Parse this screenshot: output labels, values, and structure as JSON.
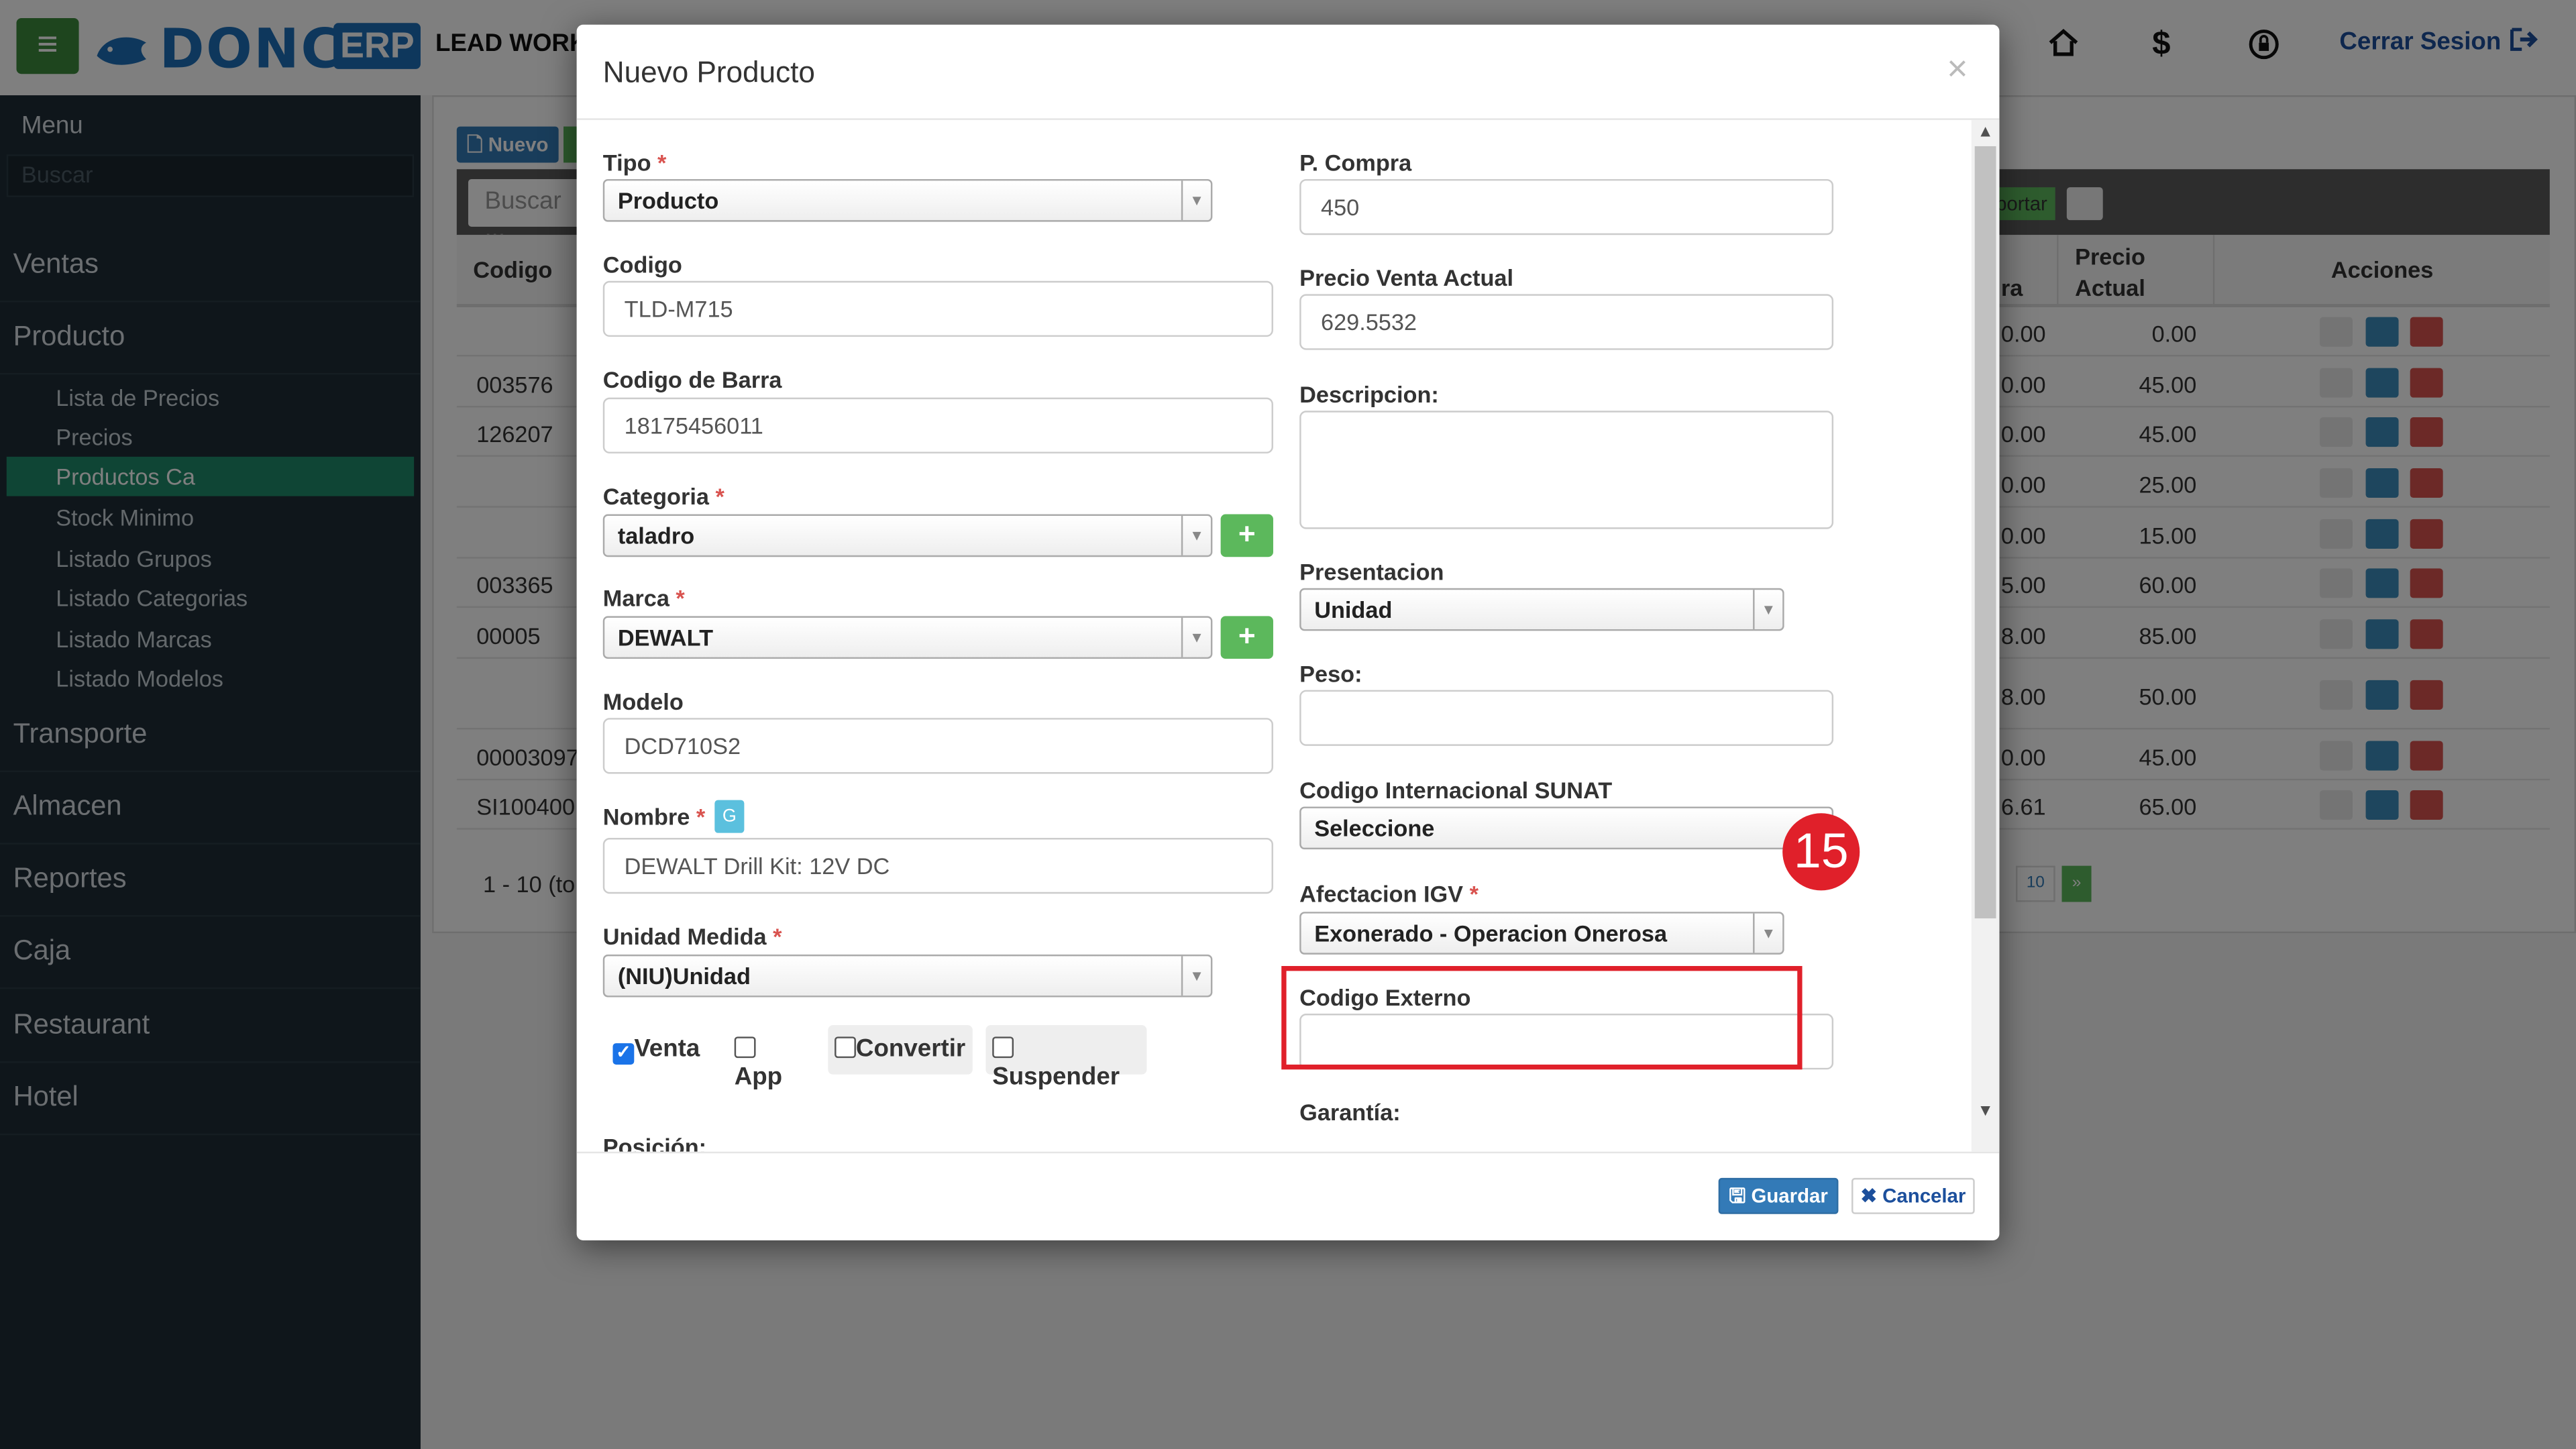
{
  "header": {
    "menu_toggle": "≡",
    "logo_text": "DONCA",
    "logo_badge": "ERP",
    "company": "LEAD WORK",
    "logout": "Cerrar Sesion",
    "icons": [
      "home-icon",
      "dollar-icon",
      "lock-refresh-icon",
      "logout-icon"
    ]
  },
  "sidebar": {
    "title": "Menu",
    "search_placeholder": "Buscar",
    "items": [
      "Ventas",
      "Producto",
      "Transporte",
      "Almacen",
      "Reportes",
      "Caja",
      "Restaurant",
      "Hotel"
    ],
    "product_subitems": [
      "Lista de Precios",
      "Precios",
      "Productos Ca",
      "Stock Minimo",
      "Listado Grupos",
      "Listado Categorias",
      "Listado Marcas",
      "Listado Modelos"
    ],
    "active_subitem": "Productos Ca"
  },
  "background": {
    "btn_nuevo": "Nuevo",
    "search_placeholder": "Buscar ...",
    "btn_exportar": "portar",
    "columns": {
      "codigo": "Codigo",
      "precio_compra": "ra",
      "precio_actual": "Precio Actual",
      "acciones": "Acciones"
    },
    "rows": [
      {
        "codigo": "",
        "ca": "0.00",
        "pa": "0.00"
      },
      {
        "codigo": "003576",
        "ca": "0.00",
        "pa": "45.00"
      },
      {
        "codigo": "126207",
        "ca": "0.00",
        "pa": "45.00"
      },
      {
        "codigo": "",
        "ca": "0.00",
        "pa": "25.00"
      },
      {
        "codigo": "",
        "ca": "0.00",
        "pa": "15.00"
      },
      {
        "codigo": "003365",
        "ca": "5.00",
        "pa": "60.00"
      },
      {
        "codigo": "00005",
        "ca": "8.00",
        "pa": "85.00"
      },
      {
        "codigo": "",
        "ca": "8.00",
        "pa": "50.00"
      },
      {
        "codigo": "00003097",
        "ca": "0.00",
        "pa": "45.00"
      },
      {
        "codigo": "SI100400",
        "ca": "6.61",
        "pa": "65.00"
      }
    ],
    "pagination_text": "1 - 10 (to",
    "page_10": "10",
    "page_next": "»"
  },
  "modal": {
    "title": "Nuevo Producto",
    "close": "×",
    "left": {
      "tipo_label": "Tipo",
      "tipo_value": "Producto",
      "codigo_label": "Codigo",
      "codigo_value": "TLD-M715",
      "barra_label": "Codigo de Barra",
      "barra_value": "18175456011",
      "categoria_label": "Categoria",
      "categoria_value": "taladro",
      "marca_label": "Marca",
      "marca_value": "DEWALT",
      "modelo_label": "Modelo",
      "modelo_value": "DCD710S2",
      "nombre_label": "Nombre",
      "nombre_badge": "G",
      "nombre_value": "DEWALT Drill Kit: 12V DC",
      "unidad_label": "Unidad Medida",
      "unidad_value": "(NIU)Unidad",
      "checkboxes": [
        {
          "label": "Venta",
          "checked": true
        },
        {
          "label": "App",
          "checked": false
        },
        {
          "label": "Convertir",
          "checked": false
        },
        {
          "label": "Suspender",
          "checked": false
        }
      ],
      "posicion_label": "Posición:"
    },
    "right": {
      "pcompra_label": "P. Compra",
      "pcompra_value": "450",
      "pventa_label": "Precio Venta Actual",
      "pventa_value": "629.5532",
      "descripcion_label": "Descripcion:",
      "descripcion_value": "",
      "presentacion_label": "Presentacion",
      "presentacion_value": "Unidad",
      "peso_label": "Peso:",
      "peso_value": "",
      "sunat_label": "Codigo Internacional SUNAT",
      "sunat_value": "Seleccione",
      "igv_label": "Afectacion IGV",
      "igv_value": "Exonerado - Operacion Onerosa",
      "externo_label": "Codigo Externo",
      "externo_value": "",
      "garantia_label": "Garantía:"
    },
    "required_mark": "*",
    "step_number": "15",
    "save_button": "Guardar",
    "cancel_button": "Cancelar"
  },
  "colors": {
    "accent": "#337ab7",
    "success": "#5cb85c",
    "highlight": "#e0202a",
    "sidebar": "#1f2d36",
    "active_item": "#1f8a6b"
  }
}
